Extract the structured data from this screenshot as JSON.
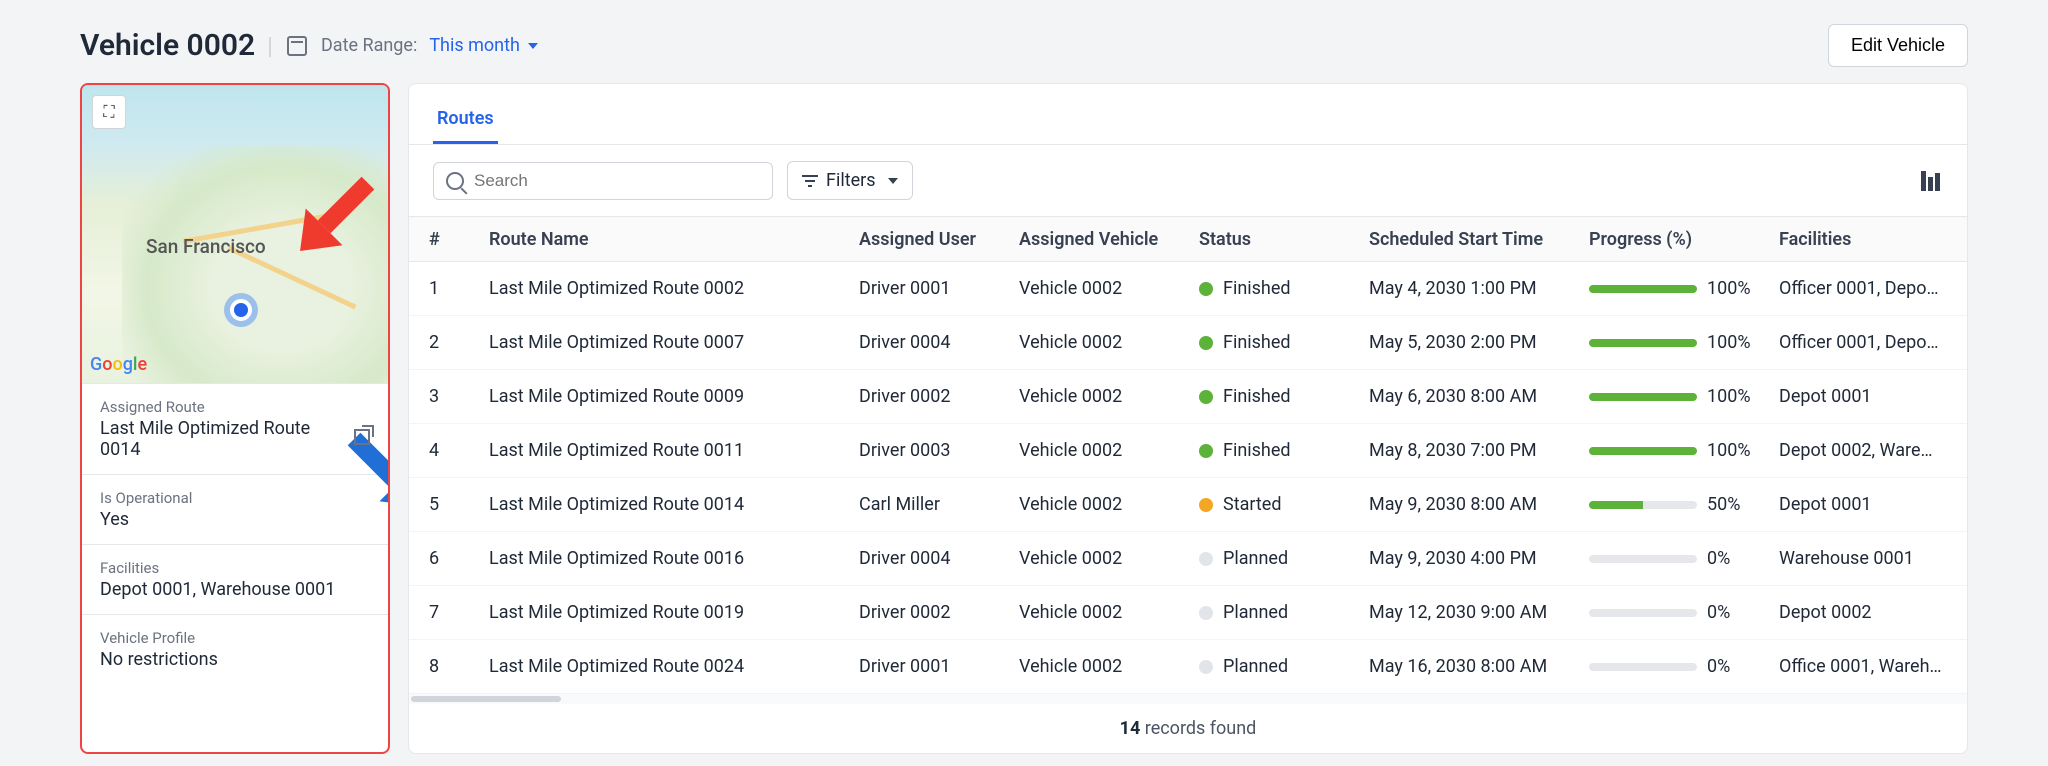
{
  "header": {
    "title": "Vehicle 0002",
    "date_label": "Date Range:",
    "date_value": "This month",
    "edit_label": "Edit Vehicle"
  },
  "map": {
    "city": "San Francisco",
    "logo": "Google"
  },
  "side": {
    "assigned_route_k": "Assigned Route",
    "assigned_route_v": "Last Mile Optimized Route 0014",
    "operational_k": "Is Operational",
    "operational_v": "Yes",
    "facilities_k": "Facilities",
    "facilities_v": "Depot 0001, Warehouse 0001",
    "profile_k": "Vehicle Profile",
    "profile_v": "No restrictions"
  },
  "tabs": {
    "routes": "Routes"
  },
  "toolbar": {
    "search_ph": "Search",
    "filters": "Filters"
  },
  "columns": [
    "#",
    "Route Name",
    "Assigned User",
    "Assigned Vehicle",
    "Status",
    "Scheduled Start Time",
    "Progress (%)",
    "Facilities"
  ],
  "rows": [
    {
      "n": "1",
      "name": "Last Mile Optimized Route 0002",
      "user": "Driver 0001",
      "vehicle": "Vehicle 0002",
      "status": "Finished",
      "dot": "g",
      "time": "May 4, 2030 1:00 PM",
      "pct": 100,
      "fac": "Officer 0001, Depo…"
    },
    {
      "n": "2",
      "name": "Last Mile Optimized Route 0007",
      "user": "Driver 0004",
      "vehicle": "Vehicle 0002",
      "status": "Finished",
      "dot": "g",
      "time": "May 5, 2030 2:00 PM",
      "pct": 100,
      "fac": "Officer 0001, Depo…"
    },
    {
      "n": "3",
      "name": "Last Mile Optimized Route 0009",
      "user": "Driver 0002",
      "vehicle": "Vehicle 0002",
      "status": "Finished",
      "dot": "g",
      "time": "May 6, 2030 8:00 AM",
      "pct": 100,
      "fac": "Depot 0001"
    },
    {
      "n": "4",
      "name": "Last Mile Optimized Route 0011",
      "user": "Driver 0003",
      "vehicle": "Vehicle 0002",
      "status": "Finished",
      "dot": "g",
      "time": "May 8, 2030 7:00 PM",
      "pct": 100,
      "fac": "Depot 0002, Ware…"
    },
    {
      "n": "5",
      "name": "Last Mile Optimized Route 0014",
      "user": "Carl Miller",
      "vehicle": "Vehicle 0002",
      "status": "Started",
      "dot": "o",
      "time": "May 9, 2030 8:00 AM",
      "pct": 50,
      "fac": "Depot 0001"
    },
    {
      "n": "6",
      "name": "Last Mile Optimized Route 0016",
      "user": "Driver 0004",
      "vehicle": "Vehicle 0002",
      "status": "Planned",
      "dot": "p",
      "time": "May 9, 2030 4:00 PM",
      "pct": 0,
      "fac": "Warehouse 0001"
    },
    {
      "n": "7",
      "name": "Last Mile Optimized Route 0019",
      "user": "Driver 0002",
      "vehicle": "Vehicle 0002",
      "status": "Planned",
      "dot": "p",
      "time": "May 12, 2030 9:00 AM",
      "pct": 0,
      "fac": "Depot 0002"
    },
    {
      "n": "8",
      "name": "Last Mile Optimized Route 0024",
      "user": "Driver 0001",
      "vehicle": "Vehicle 0002",
      "status": "Planned",
      "dot": "p",
      "time": "May 16, 2030 8:00 AM",
      "pct": 0,
      "fac": "Office 0001, Wareh…"
    }
  ],
  "footer": {
    "count": "14",
    "label": "records found"
  }
}
